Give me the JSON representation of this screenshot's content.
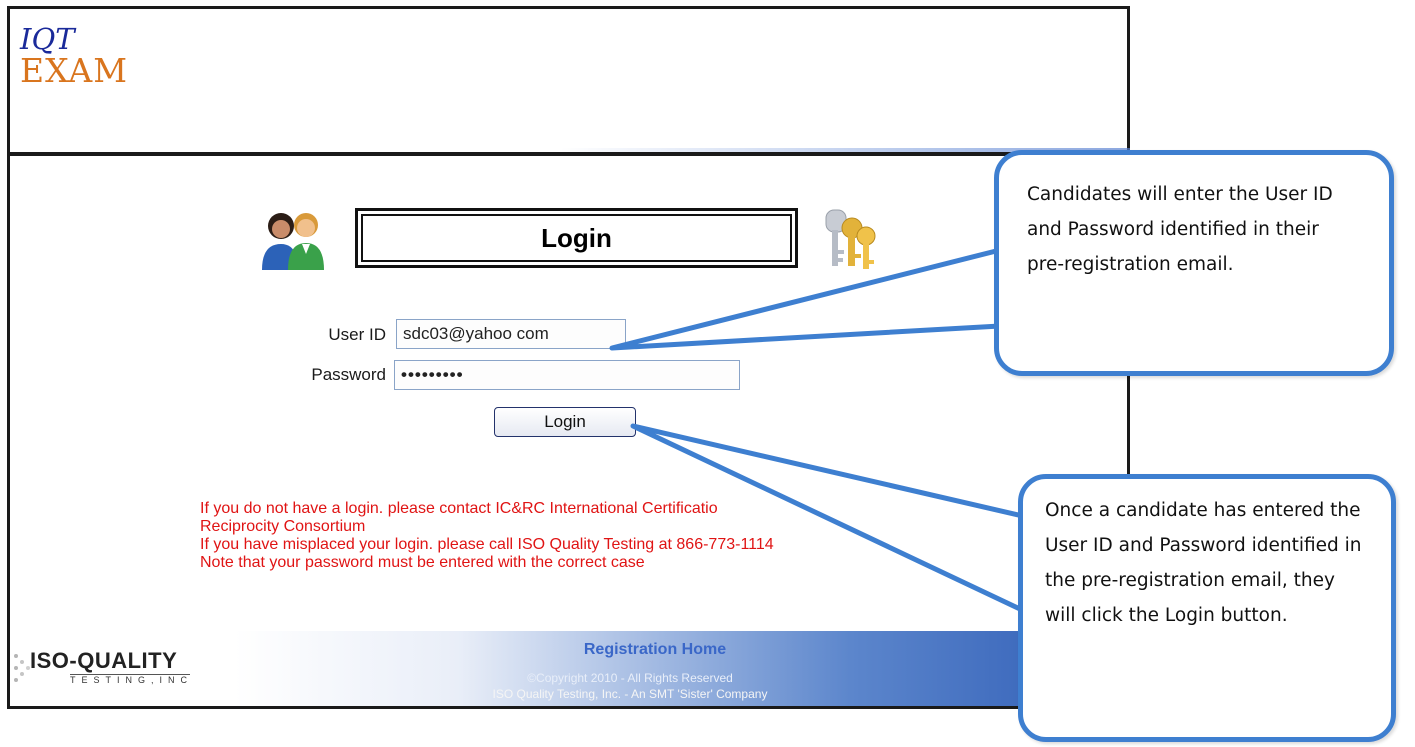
{
  "logo": {
    "line1": "IQT",
    "line2": "EXAM"
  },
  "login_panel": {
    "title": "Login",
    "user_id_label": "User ID",
    "user_id_value": "sdc03@yahoo com",
    "password_label": "Password",
    "password_value": "•••••••••",
    "login_button": "Login"
  },
  "notes": [
    "If you do not have a login. please contact IC&RC     International Certificatio",
    "Reciprocity Consortium",
    "If you have misplaced your login. please call ISO Quality Testing at 866-773-1114",
    "Note that your password must be entered with the correct case"
  ],
  "footer": {
    "company_logo": "ISO-QUALITY",
    "company_logo_sub": "TESTING,INC",
    "registration_home": "Registration Home",
    "copyright": "©Copyright 2010 - All Rights Reserved",
    "company_line": "ISO Quality Testing, Inc. - An SMT 'Sister' Company"
  },
  "callouts": {
    "top": "Candidates will enter the User ID and Password identified in their pre-registration email.",
    "bottom": "Once a candidate has entered the User ID and Password identified in the pre-registration email, they will click the Login button."
  },
  "colors": {
    "accent_blue": "#3e7fd0",
    "logo_orange": "#d9751e",
    "logo_blue": "#1a2a9a",
    "note_red": "#e01414"
  }
}
